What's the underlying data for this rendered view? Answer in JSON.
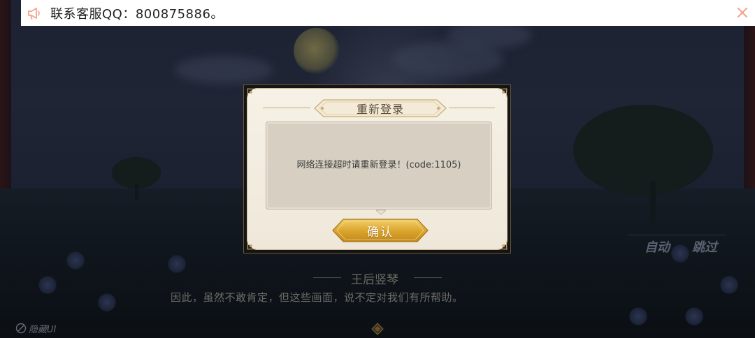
{
  "notice": {
    "icon": "megaphone-icon",
    "text": "联系客服QQ：800875886。",
    "close_icon": "close-icon",
    "accent_color": "#f4a48c"
  },
  "dialog": {
    "title": "重新登录",
    "message": "网络连接超时请重新登录！(code:1105)",
    "confirm_label": "确认",
    "button_color": "#d9a32a"
  },
  "hud": {
    "auto_label": "自动",
    "skip_label": "跳过",
    "hide_ui_label": "隐藏UI"
  },
  "story": {
    "speaker": "王后竖琴",
    "line": "因此，虽然不敢肯定，但这些画面，说不定对我们有所帮助。"
  }
}
